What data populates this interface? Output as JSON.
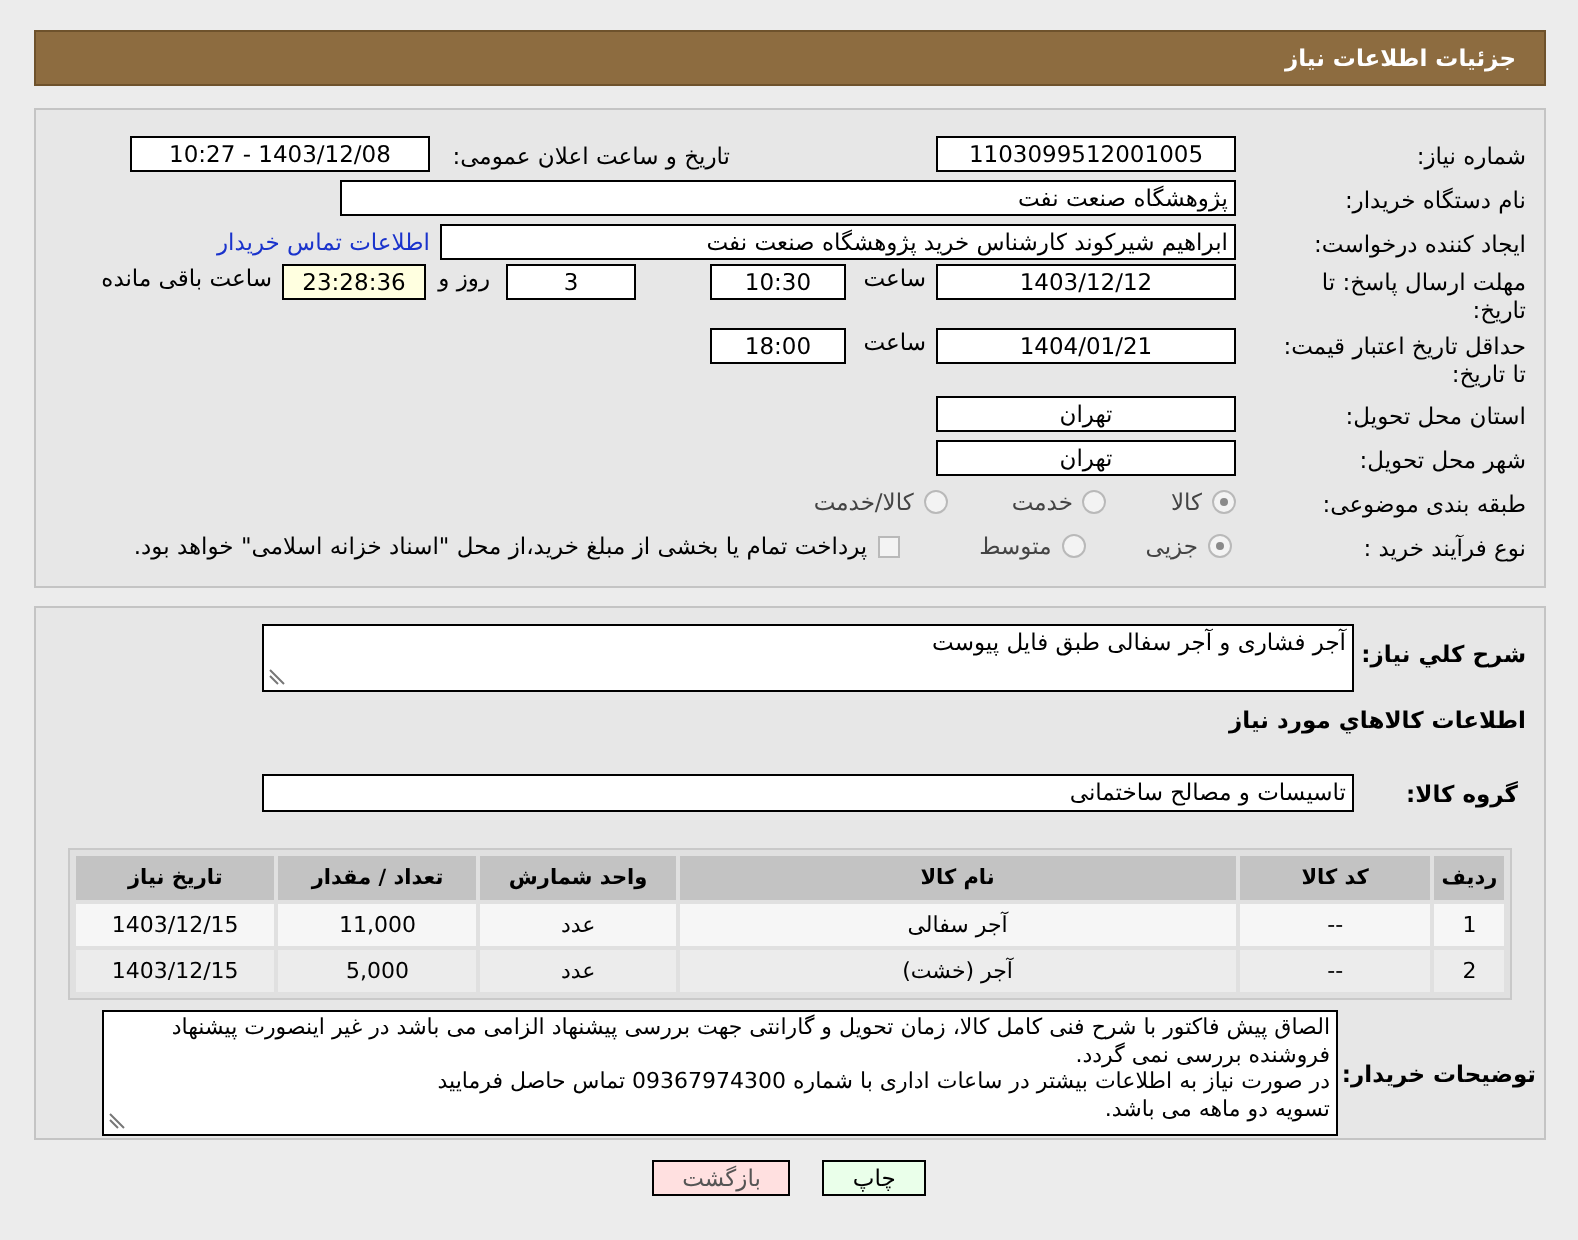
{
  "header": {
    "title": "جزئیات اطلاعات نیاز"
  },
  "form": {
    "lines": [
      {
        "items": [
          {
            "kind": "label",
            "text": "شماره نیاز:"
          },
          {
            "kind": "field",
            "text": "1103099512001005"
          },
          {
            "kind": "label",
            "text": "تاریخ و ساعت اعلان عمومی:"
          },
          {
            "kind": "field",
            "text": "1403/12/08 - 10:27"
          }
        ]
      },
      {
        "items": [
          {
            "kind": "label",
            "text": "نام دستگاه خریدار:"
          },
          {
            "kind": "field",
            "text": "پژوهشگاه صنعت نفت"
          }
        ]
      },
      {
        "items": [
          {
            "kind": "label",
            "text": "ایجاد کننده درخواست:"
          },
          {
            "kind": "field",
            "text": "ابراهیم شیرکوند کارشناس خرید پژوهشگاه صنعت نفت"
          },
          {
            "kind": "link",
            "text": "اطلاعات تماس خریدار"
          }
        ]
      },
      {
        "items": [
          {
            "kind": "label",
            "text": "مهلت ارسال پاسخ: تا تاریخ:"
          },
          {
            "kind": "field",
            "text": "1403/12/12"
          },
          {
            "kind": "text",
            "text": "ساعت"
          },
          {
            "kind": "field",
            "text": "10:30"
          },
          {
            "kind": "field",
            "text": "3"
          },
          {
            "kind": "text",
            "text": "روز و"
          },
          {
            "kind": "countdown",
            "text": "23:28:36"
          },
          {
            "kind": "text",
            "text": "ساعت باقی مانده"
          }
        ]
      },
      {
        "items": [
          {
            "kind": "label",
            "text": "حداقل تاریخ اعتبار قیمت: تا تاریخ:"
          },
          {
            "kind": "field",
            "text": "1404/01/21"
          },
          {
            "kind": "text",
            "text": "ساعت"
          },
          {
            "kind": "field",
            "text": "18:00"
          }
        ]
      },
      {
        "items": [
          {
            "kind": "label",
            "text": "استان محل تحویل:"
          },
          {
            "kind": "field",
            "text": "تهران"
          }
        ]
      },
      {
        "items": [
          {
            "kind": "label",
            "text": "شهر محل تحویل:"
          },
          {
            "kind": "field",
            "text": "تهران"
          }
        ]
      },
      {
        "items": [
          {
            "kind": "label",
            "text": "طبقه بندی موضوعی:"
          },
          {
            "kind": "radio",
            "text": "کالا",
            "selected": true
          },
          {
            "kind": "radio",
            "text": "خدمت",
            "selected": false
          },
          {
            "kind": "radio",
            "text": "کالا/خدمت",
            "selected": false
          }
        ]
      },
      {
        "items": [
          {
            "kind": "label",
            "text": "نوع فرآیند خرید :"
          },
          {
            "kind": "radio",
            "text": "جزیی",
            "selected": true
          },
          {
            "kind": "radio",
            "text": "متوسط",
            "selected": false
          },
          {
            "kind": "checkbox",
            "text": "پرداخت تمام یا بخشی از مبلغ خرید،از محل \"اسناد خزانه اسلامی\" خواهد بود.",
            "checked": false
          }
        ]
      }
    ]
  },
  "needs": {
    "description": {
      "label": "شرح کلي نياز:",
      "value": "آجر فشاری و آجر سفالی طبق فایل پیوست"
    },
    "items_heading": "اطلاعات كالاهاي مورد نياز",
    "goods_group": {
      "label": "گروه کالا:",
      "value": "تاسیسات و مصالح ساختمانی"
    },
    "table": {
      "columns": [
        "ردیف",
        "کد کالا",
        "نام کالا",
        "واحد شمارش",
        "تعداد / مقدار",
        "تاریخ نیاز"
      ],
      "rows": [
        [
          "1",
          "--",
          "آجر سفالی",
          "عدد",
          "11,000",
          "1403/12/15"
        ],
        [
          "2",
          "--",
          "آجر (خشت)",
          "عدد",
          "5,000",
          "1403/12/15"
        ]
      ]
    },
    "buyer_notes": {
      "label": "توضیحات خریدار:",
      "value": "الصاق پیش فاکتور با شرح فنی کامل کالا، زمان تحویل و گارانتی جهت بررسی پیشنهاد الزامی می باشد در غیر اینصورت پیشنهاد فروشنده بررسی نمی گردد.\nدر صورت نیاز به اطلاعات بیشتر در ساعات اداری با شماره 09367974300 تماس حاصل فرمایید\nتسویه دو ماهه می باشد."
    }
  },
  "buttons": [
    {
      "kind": "print",
      "label": "چاپ"
    },
    {
      "kind": "back",
      "label": "بازگشت"
    }
  ]
}
